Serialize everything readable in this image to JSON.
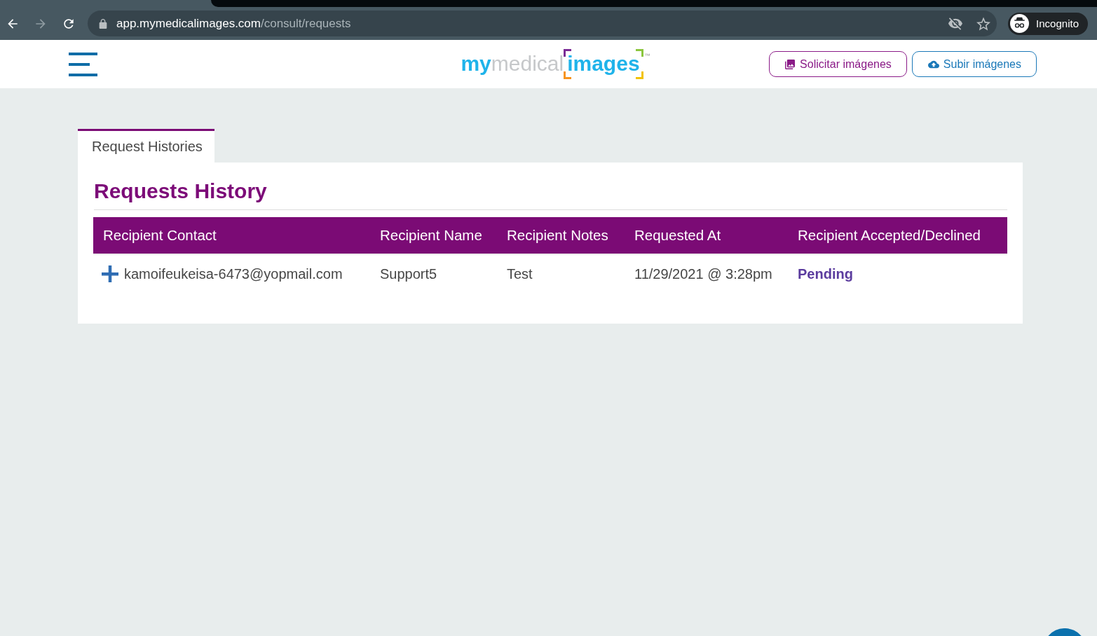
{
  "browser": {
    "url": {
      "host": "app.mymedicalimages.com",
      "path": "/consult/requests"
    },
    "profile_label": "Incognito"
  },
  "header": {
    "logo": {
      "parts": [
        {
          "kind": "bold",
          "text": "my"
        },
        {
          "kind": "light",
          "text": "medical"
        },
        {
          "kind": "bracketed",
          "text": "images"
        }
      ],
      "mark": "™"
    },
    "actions": [
      {
        "kind": "request",
        "label": "Solicitar imágenes"
      },
      {
        "kind": "upload",
        "label": "Subir imágenes"
      }
    ]
  },
  "tabs": [
    {
      "label": "Request Histories",
      "selected": true
    }
  ],
  "panel": {
    "title": "Requests History",
    "table": {
      "columns": [
        "Recipient Contact",
        "Recipient Name",
        "Recipient Notes",
        "Requested At",
        "Recipient Accepted/Declined"
      ],
      "rows": [
        {
          "expanded": false,
          "cells": [
            {
              "kind": "text",
              "text": "kamoifeukeisa-6473@yopmail.com"
            },
            {
              "kind": "text",
              "text": "Support5"
            },
            {
              "kind": "text",
              "text": "Test"
            },
            {
              "kind": "text",
              "text": "11/29/2021 @ 3:28pm"
            },
            {
              "kind": "status",
              "text": "Pending"
            }
          ]
        }
      ]
    }
  }
}
